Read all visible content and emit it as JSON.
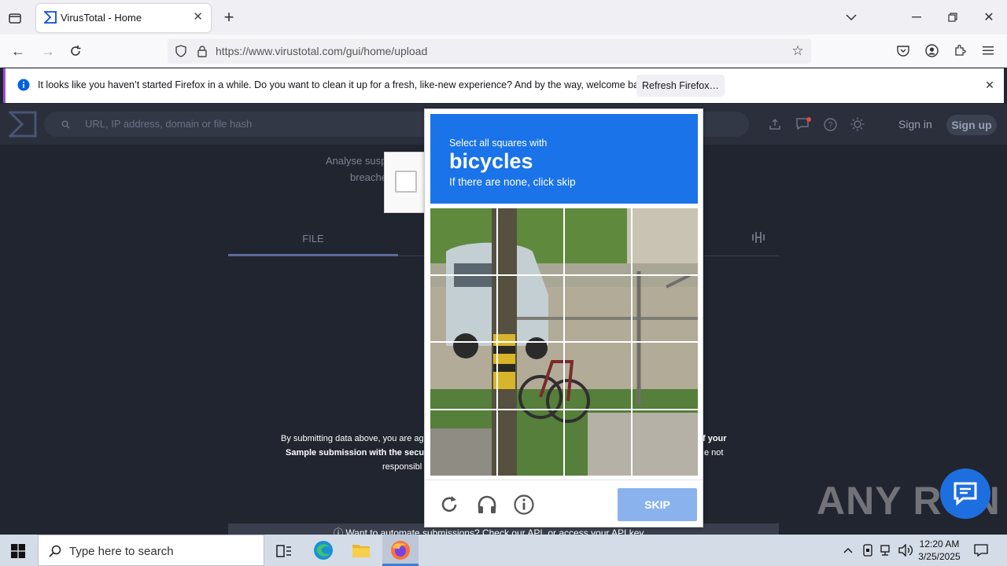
{
  "browser": {
    "tab_title": "VirusTotal - Home",
    "url": "https://www.virustotal.com/gui/home/upload",
    "notification": {
      "message": "It looks like you haven’t started Firefox in a while. Do you want to clean it up for a fresh, like-new experience? And by the way, welcome back!",
      "button": "Refresh Firefox…"
    }
  },
  "page": {
    "search_placeholder": "URL, IP address, domain or file hash",
    "sign_in": "Sign in",
    "sign_up": "Sign up",
    "intro_line1": "Analyse susp",
    "intro_line2": "breache",
    "tab_file": "FILE",
    "terms_line1_left": "By submitting data above, you are ag",
    "terms_line1_right": "f your",
    "terms_line2_left": "Sample submission with the secur",
    "terms_line2_right": "e not",
    "terms_line3_left": "responsibl",
    "bottom_text": "ⓘ Want to automate submissions? Check our API, or access your API key."
  },
  "captcha": {
    "instruction_line1": "Select all squares with",
    "target": "bicycles",
    "instruction_line3": "If there are none, click skip",
    "skip_label": "SKIP",
    "header_color": "#1a73e8"
  },
  "taskbar": {
    "search_placeholder": "Type here to search",
    "time": "12:20 AM",
    "date": "3/25/2025"
  },
  "watermark": "ANY RUN"
}
